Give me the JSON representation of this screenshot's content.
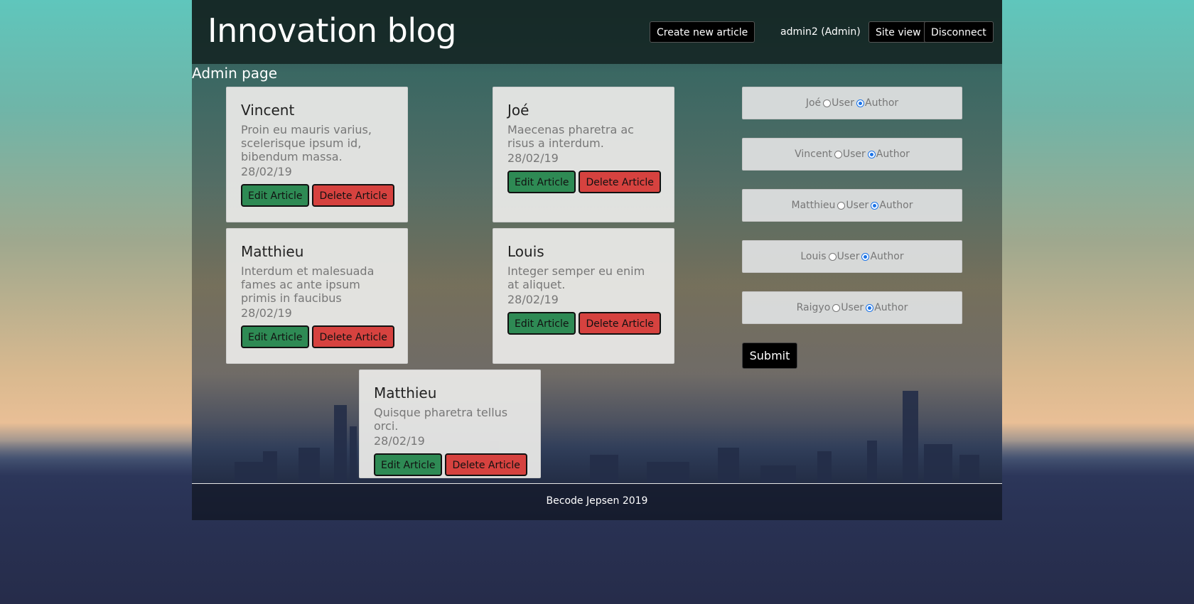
{
  "header": {
    "site_title": "Innovation blog",
    "create_label": "Create new article",
    "user_label": "admin2 (Admin)",
    "site_view_label": "Site view",
    "disconnect_label": "Disconnect"
  },
  "page": {
    "title": "Admin page"
  },
  "articles": [
    {
      "author": "Vincent",
      "excerpt": "Proin eu mauris varius, scelerisque ipsum id, bibendum massa.",
      "date": "28/02/19",
      "edit_label": "Edit Article",
      "delete_label": "Delete Article"
    },
    {
      "author": "Joé",
      "excerpt": "Maecenas pharetra ac risus a interdum.",
      "date": "28/02/19",
      "edit_label": "Edit Article",
      "delete_label": "Delete Article"
    },
    {
      "author": "Matthieu",
      "excerpt": "Interdum et malesuada fames ac ante ipsum primis in faucibus",
      "date": "28/02/19",
      "edit_label": "Edit Article",
      "delete_label": "Delete Article"
    },
    {
      "author": "Louis",
      "excerpt": "Integer semper eu enim at aliquet.",
      "date": "28/02/19",
      "edit_label": "Edit Article",
      "delete_label": "Delete Article"
    },
    {
      "author": "Matthieu",
      "excerpt": "Quisque pharetra tellus orci.",
      "date": "28/02/19",
      "edit_label": "Edit Article",
      "delete_label": "Delete Article"
    }
  ],
  "roles": {
    "user_option": "User",
    "author_option": "Author",
    "users": [
      {
        "name": "Joé",
        "selected": "Author"
      },
      {
        "name": "Vincent",
        "selected": "Author"
      },
      {
        "name": "Matthieu",
        "selected": "Author"
      },
      {
        "name": "Louis",
        "selected": "Author"
      },
      {
        "name": "Raigyo",
        "selected": "Author"
      }
    ],
    "submit_label": "Submit"
  },
  "footer": {
    "text": "Becode Jepsen 2019"
  },
  "colors": {
    "edit_button": "#2e8a54",
    "delete_button": "#d6423f",
    "radio_checked": "#1a73e8"
  }
}
